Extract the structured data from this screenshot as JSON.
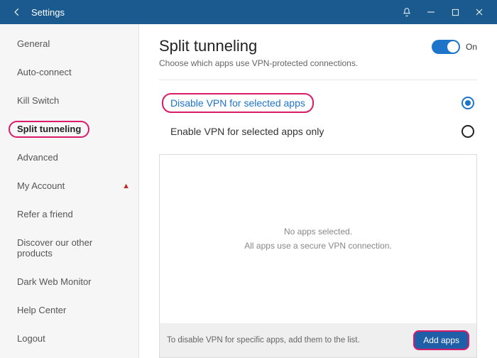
{
  "titlebar": {
    "title": "Settings"
  },
  "sidebar": {
    "items": [
      {
        "label": "General"
      },
      {
        "label": "Auto-connect"
      },
      {
        "label": "Kill Switch"
      },
      {
        "label": "Split tunneling"
      },
      {
        "label": "Advanced"
      },
      {
        "label": "My Account"
      },
      {
        "label": "Refer a friend"
      },
      {
        "label": "Discover our other products"
      },
      {
        "label": "Dark Web Monitor"
      }
    ],
    "bottom": [
      {
        "label": "Help Center"
      },
      {
        "label": "Logout"
      }
    ]
  },
  "main": {
    "heading": "Split tunneling",
    "subheading": "Choose which apps use VPN-protected connections.",
    "toggle_label": "On",
    "options": {
      "disable": "Disable VPN for selected apps",
      "enable": "Enable VPN for selected apps only"
    },
    "empty": {
      "line1": "No apps selected.",
      "line2": "All apps use a secure VPN connection."
    },
    "footer_hint": "To disable VPN for specific apps, add them to the list.",
    "add_button": "Add apps"
  }
}
